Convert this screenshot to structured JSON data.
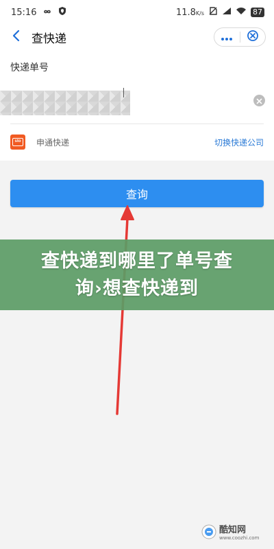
{
  "status_bar": {
    "time": "15:16",
    "network_speed": "11.8",
    "network_speed_unit": "K/s",
    "battery": "87"
  },
  "title_bar": {
    "title": "查快递",
    "more_icon": "more-dots-icon",
    "close_icon": "close-circle-icon"
  },
  "form": {
    "tracking_label": "快递单号",
    "tracking_value_visible": false,
    "courier_name": "申通快递",
    "courier_logo_text": "sto",
    "courier_logo_color": "#f15a22",
    "switch_label": "切换快递公司"
  },
  "query_button": {
    "label": "查询",
    "color": "#2d8ef0"
  },
  "annotation": {
    "arrow_color": "#e53935"
  },
  "overlay": {
    "text": "查快递到哪里了单号查询›想查快递到",
    "color": "#5c9c66"
  },
  "watermark": {
    "name": "酷知网",
    "url": "www.coozhi.com"
  }
}
